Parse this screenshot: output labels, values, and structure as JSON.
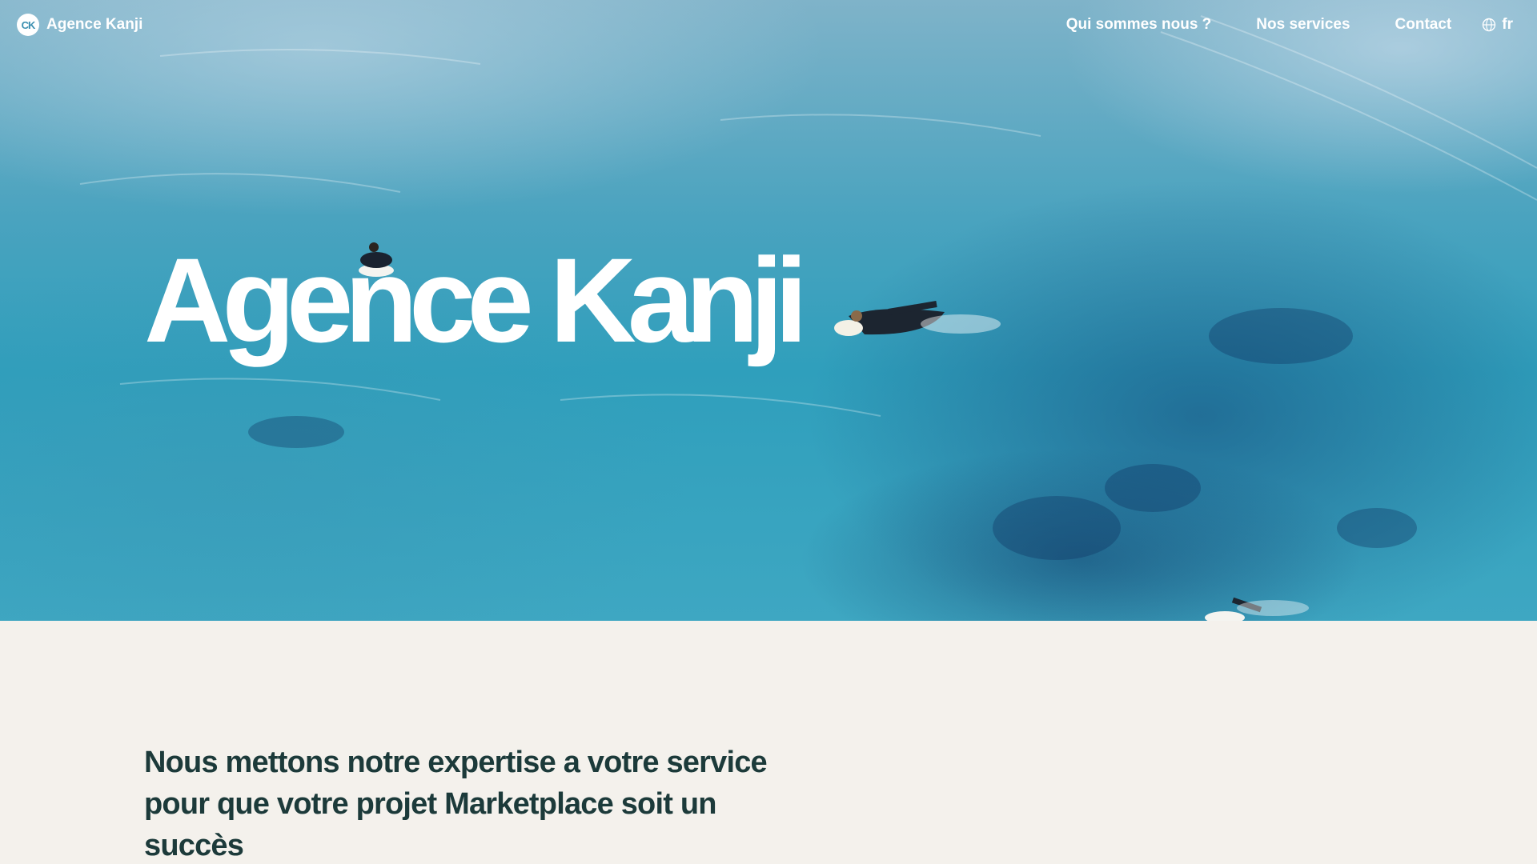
{
  "brand": {
    "logo_text": "CK",
    "name": "Agence Kanji"
  },
  "nav": {
    "links": [
      {
        "label": "Qui sommes nous ?"
      },
      {
        "label": "Nos services"
      },
      {
        "label": "Contact"
      }
    ],
    "language": {
      "icon": "globe-icon",
      "label": "fr"
    }
  },
  "hero": {
    "title": "Agence Kanji",
    "background": "aerial view of surfers paddling on turquoise ocean"
  },
  "intro": {
    "text": "Nous mettons notre expertise a votre service pour que votre projet Marketplace soit un succès"
  },
  "colors": {
    "page_background": "#f4f1ec",
    "intro_text": "#1c3a3a",
    "nav_text": "#ffffff",
    "ocean": "#3aa5c1"
  }
}
